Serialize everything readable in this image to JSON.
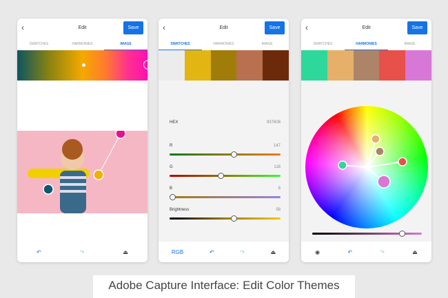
{
  "header": {
    "back_icon": "chevron-left-icon",
    "title": "Edit",
    "save_label": "Save"
  },
  "tabs": [
    "SWATCHES",
    "HARMONIES",
    "IMAGE"
  ],
  "phone1": {
    "active_tab": "IMAGE"
  },
  "phone2": {
    "active_tab": "SWATCHES",
    "swatches": [
      "#ececec",
      "#e3b512",
      "#a07c08",
      "#b87050",
      "#6c2a0a"
    ],
    "hex_label": "HEX",
    "hex_value": "937608",
    "sliders": [
      {
        "label": "R",
        "value": "147",
        "fraction": 0.58
      },
      {
        "label": "G",
        "value": "118",
        "fraction": 0.46
      },
      {
        "label": "B",
        "value": "8",
        "fraction": 0.03
      },
      {
        "label": "Brightness",
        "value": "58",
        "fraction": 0.58
      }
    ],
    "mode_label": "RGB"
  },
  "phone3": {
    "active_tab": "HARMONIES",
    "swatches": [
      "#2ed89a",
      "#e6b06a",
      "#ad8468",
      "#e8504a",
      "#d878d6"
    ],
    "brightness_fraction": 0.82
  },
  "caption": "Adobe Capture Interface: Edit Color Themes"
}
